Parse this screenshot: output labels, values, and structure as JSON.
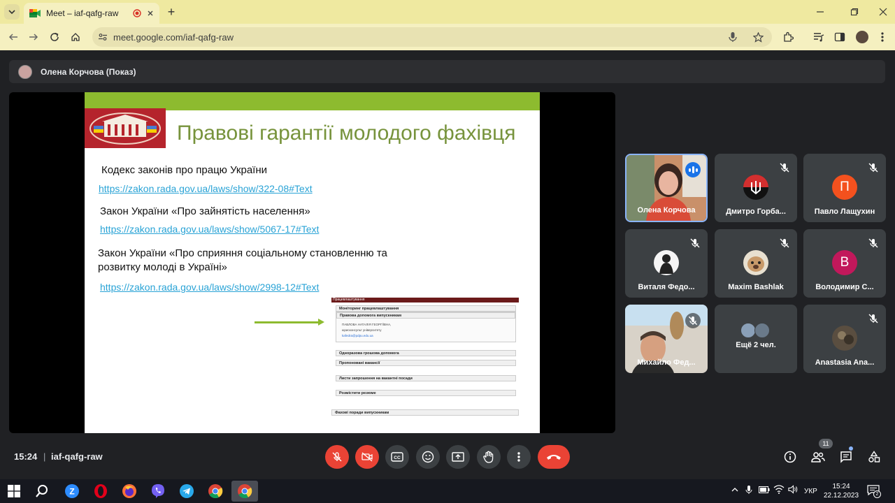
{
  "browser": {
    "tab_title": "Meet – iaf-qafg-raw",
    "new_tab_symbol": "+",
    "url": "meet.google.com/iaf-qafg-raw",
    "window_controls": [
      "minimize-icon",
      "restore-icon",
      "close-icon"
    ]
  },
  "meet": {
    "presenter_label": "Олена Корчова (Показ)",
    "slide": {
      "title": "Правові гарантії молодого фахівця",
      "items": [
        {
          "text": "Кодекс законів про працю України",
          "link": "https://zakon.rada.gov.ua/laws/show/322-08#Text"
        },
        {
          "text": "Закон України «Про зайнятість населення»",
          "link": "https://zakon.rada.gov.ua/laws/show/5067-17#Text"
        },
        {
          "text": "Закон України «Про сприяння соціальному становленню та",
          "text2": "розвитку молоді в Україні»",
          "link": "https://zakon.rada.gov.ua/laws/show/2998-12#Text"
        }
      ],
      "mini_screenshot": {
        "header": "Працевлаштування",
        "rows": [
          "Моніторинг працевлаштування",
          "Правова допомога випускникам",
          "Одноразова грошова допомога",
          "Пропоновані вакансії",
          "Листи запрошення на вакантні посади",
          "Розмістити резюме",
          "Фахові поради випускникам"
        ],
        "contact_name": "ПАВЛОВА НАТАЛІЯ ГЕОРГІЇВНА,",
        "contact_role": "юрисконсульт університету",
        "contact_email": "kafedra@pdpu.edu.ua"
      }
    },
    "participants": [
      {
        "name": "Олена Корчова",
        "speaking": true,
        "avatar": "video"
      },
      {
        "name": "Дмитро Горба...",
        "muted": true,
        "avatar": "trident-icon"
      },
      {
        "name": "Павло Лащухин",
        "muted": true,
        "initial": "П",
        "color": "#f4511e"
      },
      {
        "name": "Виталя Федо...",
        "muted": true,
        "avatar": "photo"
      },
      {
        "name": "Maxim Bashlak",
        "muted": true,
        "avatar": "photo"
      },
      {
        "name": "Володимир С...",
        "muted": true,
        "initial": "В",
        "color": "#c2185b"
      },
      {
        "name": "Михайло Фед...",
        "muted": true,
        "avatar": "video"
      },
      {
        "name": "Ещё 2 чел.",
        "avatar": "group"
      },
      {
        "name": "Anastasia Ana...",
        "muted": true,
        "avatar": "photo"
      }
    ],
    "bottom": {
      "time": "15:24",
      "separator": "|",
      "meeting_code": "iaf-qafg-raw",
      "people_count": "11"
    }
  },
  "taskbar": {
    "language": "УКР",
    "time": "15:24",
    "date": "22.12.2023",
    "notification_count": "2"
  }
}
